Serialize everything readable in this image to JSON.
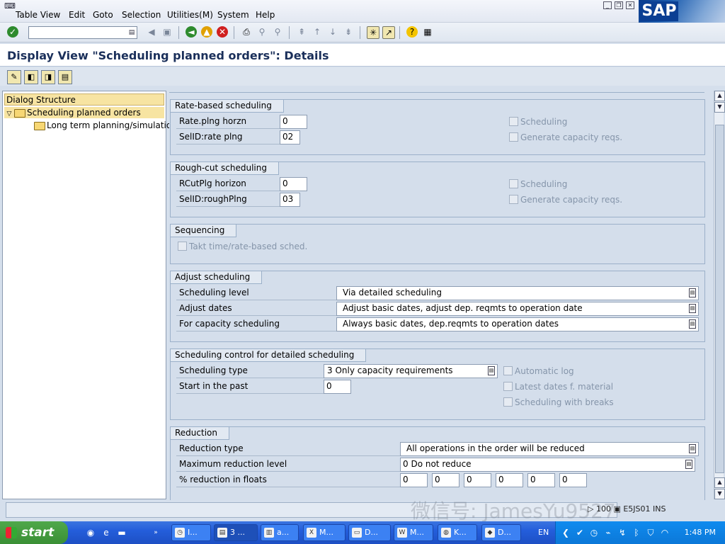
{
  "menu": {
    "items": [
      "Table View",
      "Edit",
      "Goto",
      "Selection",
      "Utilities(M)",
      "System",
      "Help"
    ],
    "logo": "SAP"
  },
  "toolbar": {
    "command_value": ""
  },
  "title": "Display View \"Scheduling planned orders\": Details",
  "tree": {
    "header": "Dialog Structure",
    "items": [
      {
        "label": "Scheduling planned orders",
        "selected": true
      },
      {
        "label": "Long term planning/simulation",
        "selected": false
      }
    ]
  },
  "groups": {
    "rate": {
      "title": "Rate-based scheduling",
      "fields": [
        {
          "label": "Rate.plng horzn",
          "value": "0"
        },
        {
          "label": "SelID:rate plng",
          "value": "02"
        }
      ],
      "checks": [
        "Scheduling",
        "Generate capacity reqs."
      ]
    },
    "rough": {
      "title": "Rough-cut scheduling",
      "fields": [
        {
          "label": "RCutPlg horizon",
          "value": "0"
        },
        {
          "label": "SelID:roughPlng",
          "value": "03"
        }
      ],
      "checks": [
        "Scheduling",
        "Generate capacity reqs."
      ]
    },
    "seq": {
      "title": "Sequencing",
      "checks": [
        "Takt time/rate-based sched."
      ]
    },
    "adjust": {
      "title": "Adjust scheduling",
      "fields": [
        {
          "label": "Scheduling level",
          "value": "Via detailed scheduling"
        },
        {
          "label": "Adjust dates",
          "value": "Adjust basic dates, adjust dep. reqmts to operation date"
        },
        {
          "label": "For capacity scheduling",
          "value": "Always basic dates, dep.reqmts to operation dates"
        }
      ]
    },
    "control": {
      "title": "Scheduling control for detailed scheduling",
      "fields": [
        {
          "label": "Scheduling type",
          "value": "3 Only capacity requirements"
        },
        {
          "label": "Start in the past",
          "value": "0"
        }
      ],
      "checks": [
        "Automatic log",
        "Latest dates f. material",
        "Scheduling with breaks"
      ]
    },
    "reduction": {
      "title": "Reduction",
      "fields": [
        {
          "label": "Reduction type",
          "value": "All operations in the order will be reduced"
        },
        {
          "label": "Maximum reduction level",
          "value": "0 Do not reduce"
        },
        {
          "label": "% reduction in floats",
          "values": [
            "0",
            "0",
            "0",
            "0",
            "0",
            "0"
          ]
        }
      ]
    }
  },
  "status": {
    "info": "▷ 100 ▣ E5JS01 INS",
    "watermark": "微信号: JamesYu9527"
  },
  "taskbar": {
    "start": "start",
    "tasks": [
      "I...",
      "3 ...",
      "a...",
      "M...",
      "D...",
      "M...",
      "K...",
      "D..."
    ],
    "lang": "EN",
    "clock": "1:48 PM"
  }
}
